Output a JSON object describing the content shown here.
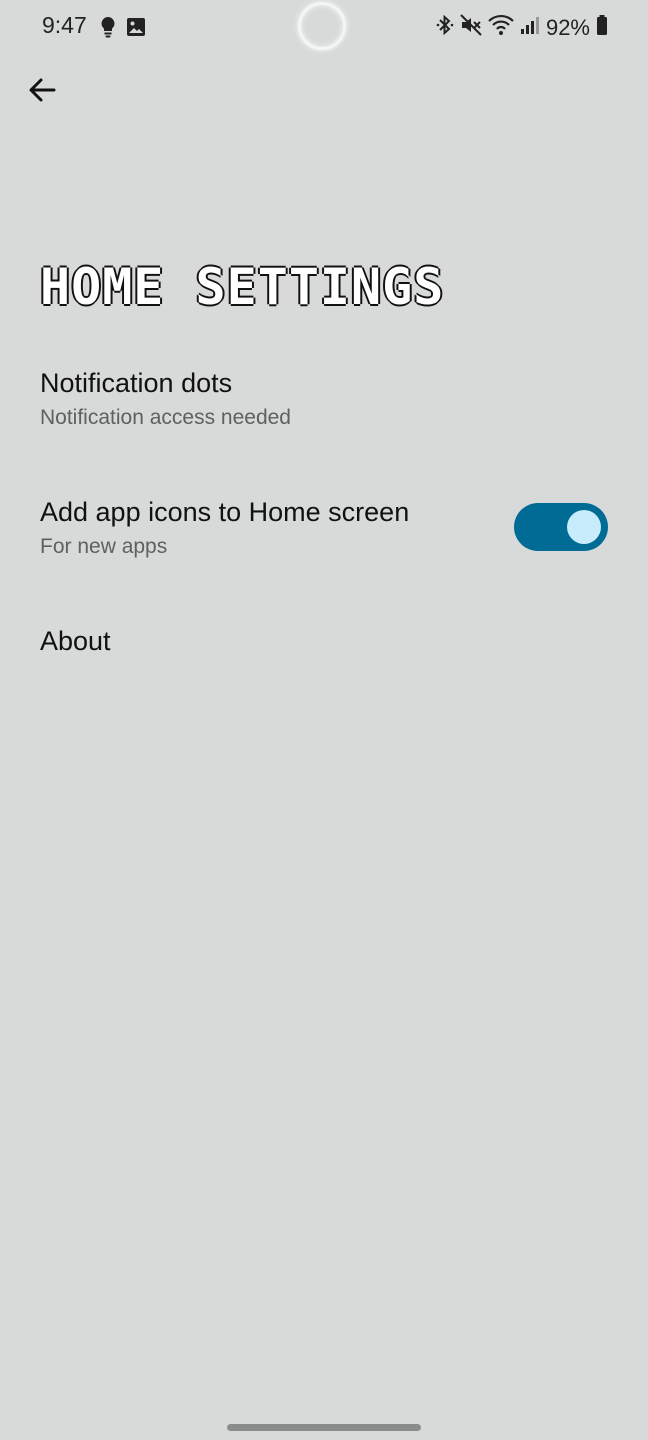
{
  "status_bar": {
    "time": "9:47",
    "left_icons": [
      "lightbulb-icon",
      "image-icon"
    ],
    "right_icons": [
      "bluetooth-icon",
      "mute-icon",
      "wifi-icon",
      "signal-icon"
    ],
    "battery": "92%"
  },
  "header": {
    "back_icon": "arrow-left-icon",
    "title": "HOME SETTINGS"
  },
  "settings": [
    {
      "title": "Notification dots",
      "subtitle": "Notification access needed"
    },
    {
      "title": "Add app icons to Home screen",
      "subtitle": "For new apps",
      "toggle_on": true
    },
    {
      "title": "About"
    }
  ],
  "colors": {
    "background": "#d8dada",
    "toggle_track": "#006b94",
    "toggle_knob": "#c8ecfb"
  }
}
